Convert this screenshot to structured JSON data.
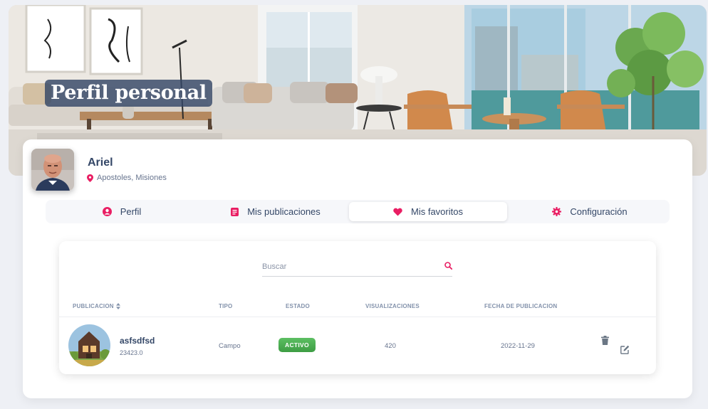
{
  "banner": {
    "title": "Perfil personal"
  },
  "profile": {
    "name": "Ariel",
    "location": "Apostoles, Misiones"
  },
  "tabs": [
    {
      "label": "Perfil",
      "icon": "user-circle-icon"
    },
    {
      "label": "Mis publicaciones",
      "icon": "document-list-icon"
    },
    {
      "label": "Mis favoritos",
      "icon": "heart-icon",
      "active": true
    },
    {
      "label": "Configuración",
      "icon": "gear-icon"
    }
  ],
  "search": {
    "placeholder": "Buscar",
    "value": ""
  },
  "table": {
    "headers": [
      "PUBLICACION",
      "TIPO",
      "ESTADO",
      "VISUALIZACIONES",
      "FECHA DE PUBLICACION"
    ],
    "rows": [
      {
        "title": "asfsdfsd",
        "subtitle": "23423.0",
        "tipo": "Campo",
        "estado": "ACTIVO",
        "visualizaciones": "420",
        "fecha": "2022-11-29"
      }
    ]
  },
  "colors": {
    "accent": "#e91e63",
    "text": "#344767",
    "badge": "#4caf50"
  }
}
